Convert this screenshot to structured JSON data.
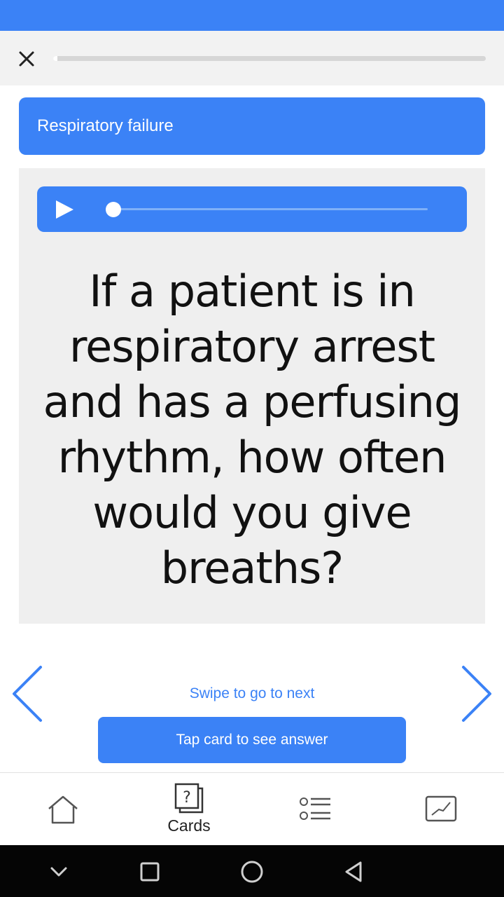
{
  "header": {
    "progress_fraction": 0.01,
    "close_icon": "close-icon"
  },
  "topic": {
    "label": "Respiratory failure"
  },
  "card": {
    "audio": {
      "play_icon": "play-icon",
      "position_fraction": 0.0
    },
    "question": "If a patient is in respiratory arrest and has a perfusing rhythm, how often would you give breaths?"
  },
  "navigation": {
    "swipe_hint": "Swipe to go to next",
    "answer_button": "Tap card to see answer",
    "prev_icon": "chevron-left-icon",
    "next_icon": "chevron-right-icon"
  },
  "bottom_nav": {
    "tabs": [
      {
        "icon": "home-icon",
        "label": ""
      },
      {
        "icon": "cards-icon",
        "label": "Cards",
        "active": true
      },
      {
        "icon": "list-icon",
        "label": ""
      },
      {
        "icon": "chart-icon",
        "label": ""
      }
    ]
  },
  "system_nav": {
    "icons": [
      "chevron-down-icon",
      "recents-icon",
      "home-circle-icon",
      "back-icon"
    ]
  },
  "colors": {
    "accent": "#3b82f6",
    "card_bg": "#efefef",
    "status_bar": "#3b82f6"
  }
}
